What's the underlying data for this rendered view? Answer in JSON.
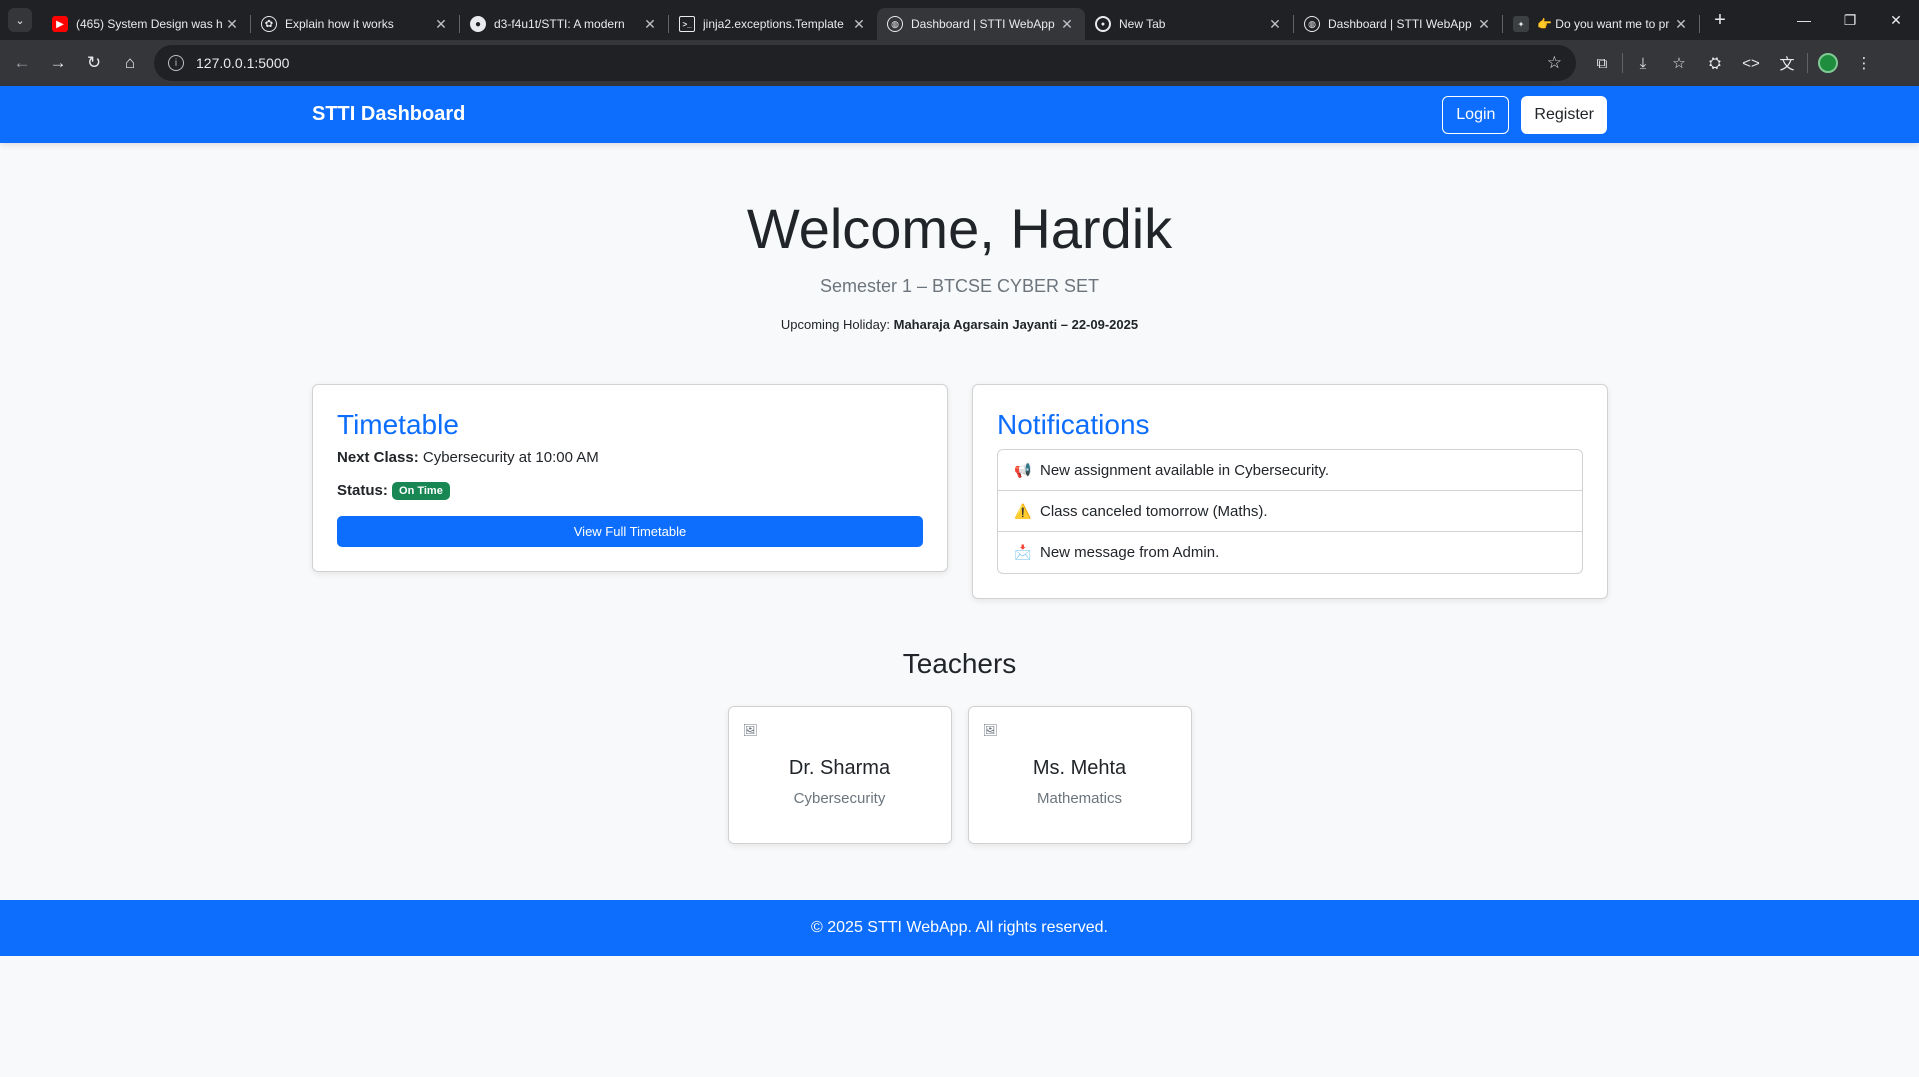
{
  "browser": {
    "tabs": [
      {
        "title": "(465) System Design was h",
        "icon": "youtube-icon",
        "color": "#ff0000"
      },
      {
        "title": "Explain how it works",
        "icon": "chatgpt-icon",
        "color": "#e8eaed"
      },
      {
        "title": "d3-f4u1t/STTI: A modern",
        "icon": "github-icon",
        "color": "#e8eaed"
      },
      {
        "title": "jinja2.exceptions.Template",
        "icon": "terminal-icon",
        "color": "#e8eaed"
      },
      {
        "title": "Dashboard | STTI WebApp",
        "icon": "globe-icon",
        "color": "#e8eaed",
        "active": true
      },
      {
        "title": "New Tab",
        "icon": "chrome-icon",
        "color": "#e8eaed"
      },
      {
        "title": "Dashboard | STTI WebApp",
        "icon": "globe-icon",
        "color": "#e8eaed"
      },
      {
        "title": "👉 Do you want me to pr",
        "icon": "app-icon",
        "color": "#e8eaed"
      }
    ],
    "url": "127.0.0.1:5000"
  },
  "navbar": {
    "brand": "STTI Dashboard",
    "login": "Login",
    "register": "Register"
  },
  "hero": {
    "welcome": "Welcome, Hardik",
    "semester": "Semester 1 – BTCSE CYBER SET",
    "holiday_label": "Upcoming Holiday:",
    "holiday_value": "Maharaja Agarsain Jayanti – 22-09-2025"
  },
  "timetable": {
    "title": "Timetable",
    "next_label": "Next Class:",
    "next_value": "Cybersecurity at 10:00 AM",
    "status_label": "Status:",
    "status_badge": "On Time",
    "button": "View Full Timetable"
  },
  "notifications": {
    "title": "Notifications",
    "items": [
      {
        "emoji": "📢",
        "text": "New assignment available in Cybersecurity."
      },
      {
        "emoji": "⚠️",
        "text": "Class canceled tomorrow (Maths)."
      },
      {
        "emoji": "📩",
        "text": "New message from Admin."
      }
    ]
  },
  "teachers": {
    "title": "Teachers",
    "list": [
      {
        "name": "Dr. Sharma",
        "subject": "Cybersecurity"
      },
      {
        "name": "Ms. Mehta",
        "subject": "Mathematics"
      }
    ]
  },
  "footer": {
    "text": "© 2025 STTI WebApp. All rights reserved."
  },
  "colors": {
    "primary": "#0d6efd",
    "success": "#198754",
    "browser_dark": "#202124"
  }
}
